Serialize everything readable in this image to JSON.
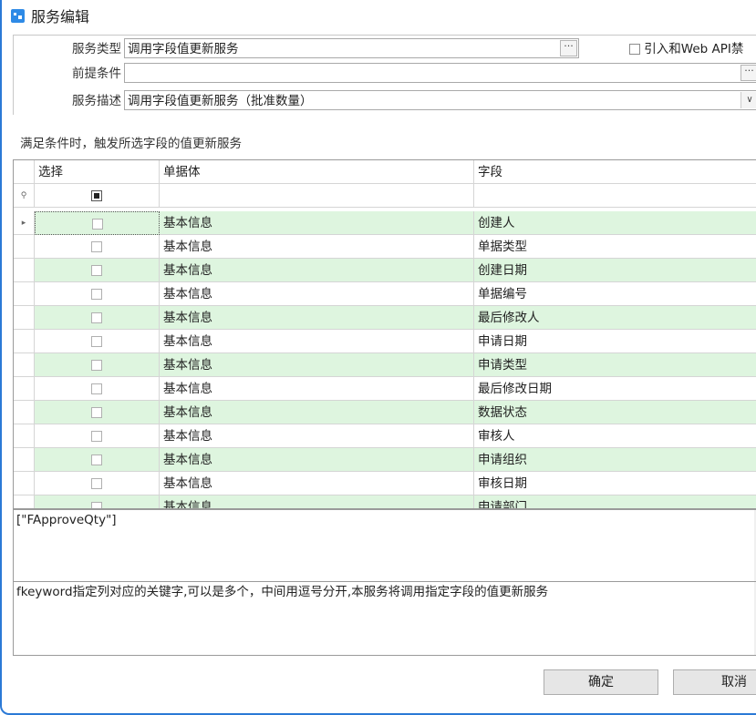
{
  "window": {
    "title": "服务编辑",
    "icon": "app-icon"
  },
  "form": {
    "service_type_label": "服务类型",
    "service_type_value": "调用字段值更新服务",
    "precondition_label": "前提条件",
    "precondition_value": "",
    "description_label": "服务描述",
    "description_value": "调用字段值更新服务（批准数量）",
    "ellipsis": "···",
    "dropdown_glyph": "∨",
    "webapi_label": "引入和Web API禁"
  },
  "section_label": "满足条件时，触发所选字段的值更新服务",
  "grid": {
    "headers": [
      "选择",
      "单据体",
      "字段"
    ],
    "filter_icon": "⚲",
    "row_indicator": "▸",
    "rows": [
      {
        "entity": "基本信息",
        "field": "创建人"
      },
      {
        "entity": "基本信息",
        "field": "单据类型"
      },
      {
        "entity": "基本信息",
        "field": "创建日期"
      },
      {
        "entity": "基本信息",
        "field": "单据编号"
      },
      {
        "entity": "基本信息",
        "field": "最后修改人"
      },
      {
        "entity": "基本信息",
        "field": "申请日期"
      },
      {
        "entity": "基本信息",
        "field": "申请类型"
      },
      {
        "entity": "基本信息",
        "field": "最后修改日期"
      },
      {
        "entity": "基本信息",
        "field": "数据状态"
      },
      {
        "entity": "基本信息",
        "field": "审核人"
      },
      {
        "entity": "基本信息",
        "field": "申请组织"
      },
      {
        "entity": "基本信息",
        "field": "审核日期"
      },
      {
        "entity": "基本信息",
        "field": "申请部门"
      }
    ]
  },
  "keyword_text": "[\"FApproveQty\"]",
  "help_text": "fkeyword指定列对应的关键字,可以是多个，中间用逗号分开,本服务将调用指定字段的值更新服务",
  "buttons": {
    "ok": "确定",
    "cancel": "取消"
  },
  "colors": {
    "accent": "#2b79d6",
    "row_alt": "#def5df"
  }
}
